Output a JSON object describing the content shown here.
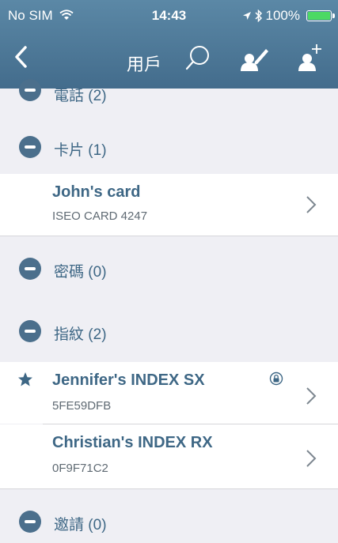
{
  "status_bar": {
    "carrier": "No SIM",
    "time": "14:43",
    "battery_text": "100%"
  },
  "nav": {
    "title": "用戶",
    "icons": [
      "back-chevron-icon",
      "search-icon",
      "edit-user-icon",
      "add-user-icon"
    ]
  },
  "sections": [
    {
      "label": "電話",
      "count": "(2)"
    },
    {
      "label": "卡片",
      "count": "(1)"
    },
    {
      "label": "密碼",
      "count": "(0)"
    },
    {
      "label": "指紋",
      "count": "(2)"
    },
    {
      "label": "邀請",
      "count": "(0)"
    }
  ],
  "items": [
    {
      "title": "John's card",
      "subtitle": "ISEO CARD 4247"
    },
    {
      "title": "Jennifer's INDEX SX",
      "subtitle": "5FE59DFB",
      "starred": true,
      "locked": true
    },
    {
      "title": "Christian's INDEX RX",
      "subtitle": "0F9F71C2"
    }
  ],
  "colors": {
    "header": "#4f7a99",
    "accent": "#3e6785",
    "battery": "#4cd964"
  }
}
